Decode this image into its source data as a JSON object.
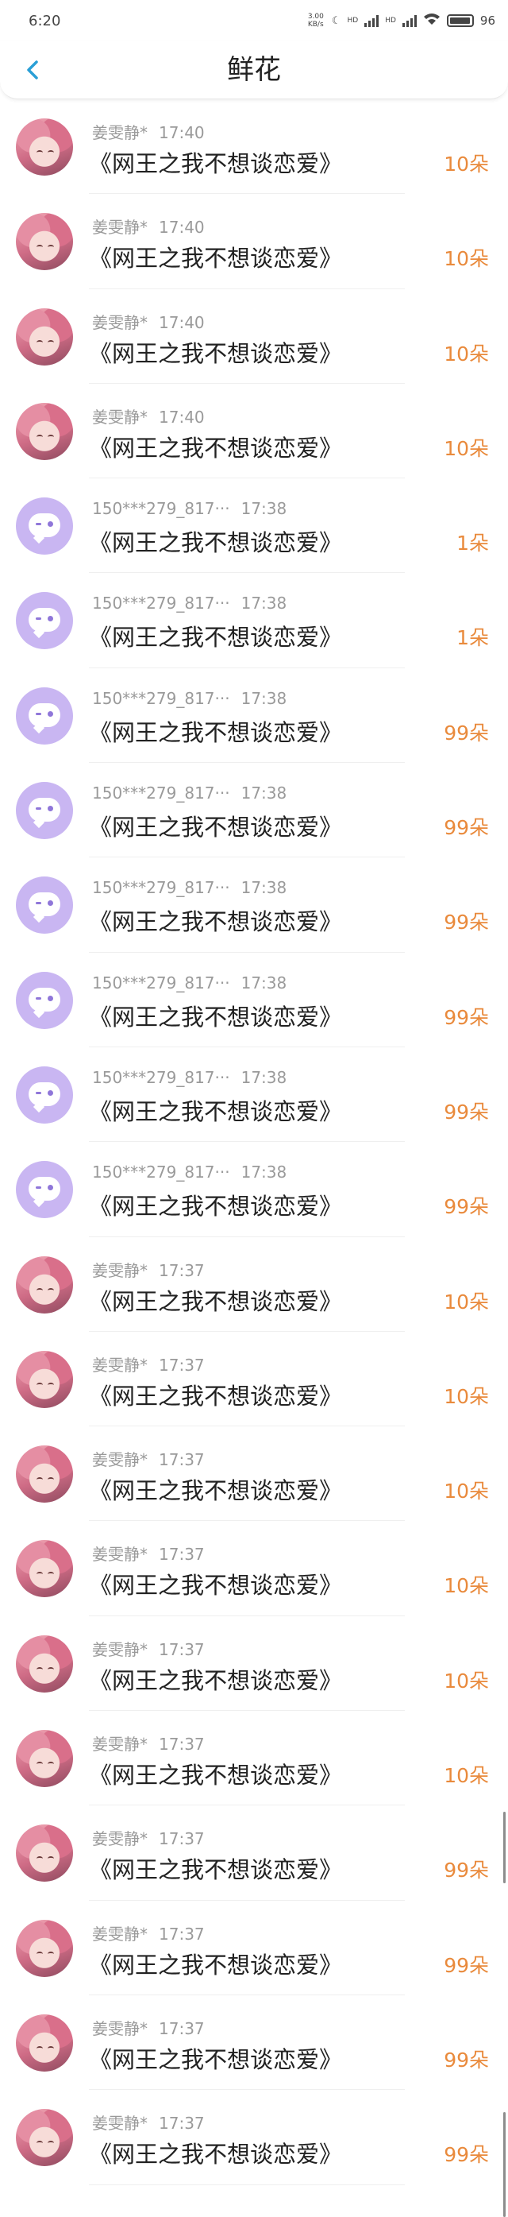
{
  "status_bar": {
    "time": "6:20",
    "speed": "3.00 KB/s",
    "sim1": "HD",
    "sim2": "HD",
    "battery": "96"
  },
  "header": {
    "back_icon": "chevron-left-icon",
    "title": "鲜花"
  },
  "colors": {
    "accent": "#2a9fd6",
    "count": "#e98a3c",
    "default_avatar": "#c9b6f2"
  },
  "items": [
    {
      "avatar": "photo",
      "user": "姜雯静*",
      "time": "17:40",
      "book": "《网王之我不想谈恋爱》",
      "count": "10朵"
    },
    {
      "avatar": "photo",
      "user": "姜雯静*",
      "time": "17:40",
      "book": "《网王之我不想谈恋爱》",
      "count": "10朵"
    },
    {
      "avatar": "photo",
      "user": "姜雯静*",
      "time": "17:40",
      "book": "《网王之我不想谈恋爱》",
      "count": "10朵"
    },
    {
      "avatar": "photo",
      "user": "姜雯静*",
      "time": "17:40",
      "book": "《网王之我不想谈恋爱》",
      "count": "10朵"
    },
    {
      "avatar": "default",
      "user": "150***279_817···",
      "time": "17:38",
      "book": "《网王之我不想谈恋爱》",
      "count": "1朵"
    },
    {
      "avatar": "default",
      "user": "150***279_817···",
      "time": "17:38",
      "book": "《网王之我不想谈恋爱》",
      "count": "1朵"
    },
    {
      "avatar": "default",
      "user": "150***279_817···",
      "time": "17:38",
      "book": "《网王之我不想谈恋爱》",
      "count": "99朵"
    },
    {
      "avatar": "default",
      "user": "150***279_817···",
      "time": "17:38",
      "book": "《网王之我不想谈恋爱》",
      "count": "99朵"
    },
    {
      "avatar": "default",
      "user": "150***279_817···",
      "time": "17:38",
      "book": "《网王之我不想谈恋爱》",
      "count": "99朵"
    },
    {
      "avatar": "default",
      "user": "150***279_817···",
      "time": "17:38",
      "book": "《网王之我不想谈恋爱》",
      "count": "99朵"
    },
    {
      "avatar": "default",
      "user": "150***279_817···",
      "time": "17:38",
      "book": "《网王之我不想谈恋爱》",
      "count": "99朵"
    },
    {
      "avatar": "default",
      "user": "150***279_817···",
      "time": "17:38",
      "book": "《网王之我不想谈恋爱》",
      "count": "99朵"
    },
    {
      "avatar": "photo",
      "user": "姜雯静*",
      "time": "17:37",
      "book": "《网王之我不想谈恋爱》",
      "count": "10朵"
    },
    {
      "avatar": "photo",
      "user": "姜雯静*",
      "time": "17:37",
      "book": "《网王之我不想谈恋爱》",
      "count": "10朵"
    },
    {
      "avatar": "photo",
      "user": "姜雯静*",
      "time": "17:37",
      "book": "《网王之我不想谈恋爱》",
      "count": "10朵"
    },
    {
      "avatar": "photo",
      "user": "姜雯静*",
      "time": "17:37",
      "book": "《网王之我不想谈恋爱》",
      "count": "10朵"
    },
    {
      "avatar": "photo",
      "user": "姜雯静*",
      "time": "17:37",
      "book": "《网王之我不想谈恋爱》",
      "count": "10朵"
    },
    {
      "avatar": "photo",
      "user": "姜雯静*",
      "time": "17:37",
      "book": "《网王之我不想谈恋爱》",
      "count": "10朵"
    },
    {
      "avatar": "photo",
      "user": "姜雯静*",
      "time": "17:37",
      "book": "《网王之我不想谈恋爱》",
      "count": "99朵"
    },
    {
      "avatar": "photo",
      "user": "姜雯静*",
      "time": "17:37",
      "book": "《网王之我不想谈恋爱》",
      "count": "99朵"
    },
    {
      "avatar": "photo",
      "user": "姜雯静*",
      "time": "17:37",
      "book": "《网王之我不想谈恋爱》",
      "count": "99朵"
    },
    {
      "avatar": "photo",
      "user": "姜雯静*",
      "time": "17:37",
      "book": "《网王之我不想谈恋爱》",
      "count": "99朵"
    }
  ]
}
